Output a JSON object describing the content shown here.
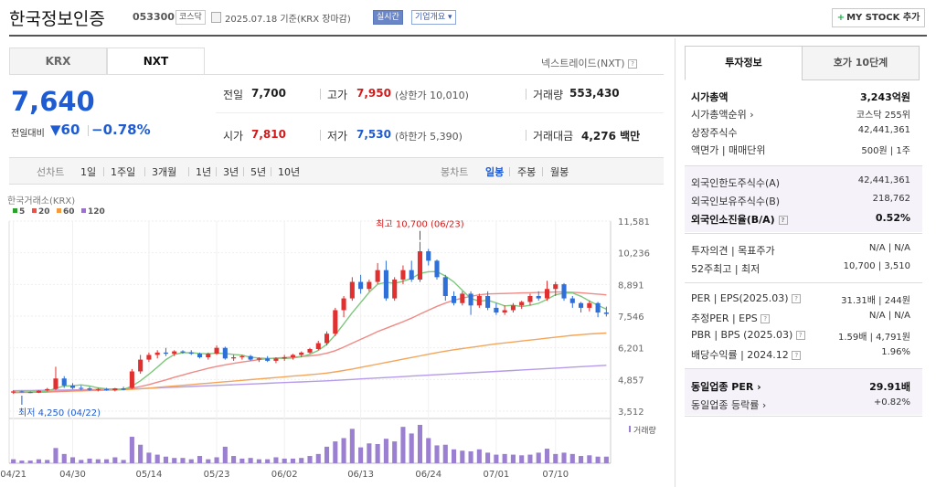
{
  "header": {
    "title": "한국정보인증",
    "code": "053300",
    "market_tag": "코스닥",
    "date_text": "2025.07.18  기준(KRX 장마감)",
    "realtime_tag": "실시간",
    "company_tag": "기업개요 ▾",
    "mystock_label": "MY STOCK 추가"
  },
  "tabs": {
    "krx": "KRX",
    "nxt": "NXT"
  },
  "nxt_link": "넥스트레이드(NXT)",
  "quote": {
    "price": "7,640",
    "change_label": "전일대비",
    "change_value": "▼60",
    "change_pct": "−0.78%",
    "prev_label": "전일",
    "prev": "7,700",
    "high_label": "고가",
    "high": "7,950",
    "upper_limit": "(상한가 10,010)",
    "volume_label": "거래량",
    "volume": "553,430",
    "open_label": "시가",
    "open": "7,810",
    "low_label": "저가",
    "low": "7,530",
    "lower_limit": "(하한가 5,390)",
    "amount_label": "거래대금",
    "amount": "4,276 백만"
  },
  "periods": {
    "line_label": "선차트",
    "items": [
      "1일",
      "1주일",
      "3개월",
      "1년",
      "3년",
      "5년",
      "10년"
    ],
    "candle_label": "봉차트",
    "candle_items": [
      "일봉",
      "주봉",
      "월봉"
    ],
    "selected": "일봉"
  },
  "right": {
    "tab_info": "투자정보",
    "tab_hoga": "호가 10단계",
    "market_cap_label": "시가총액",
    "market_cap": "3,243억원",
    "rank_label": "시가총액순위 ›",
    "rank": "코스닥 255위",
    "shares_label": "상장주식수",
    "shares": "42,441,361",
    "par_label": "액면가 | 매매단위",
    "par": "500원 | 1주",
    "foreign_limit_label": "외국인한도주식수(A)",
    "foreign_limit": "42,441,361",
    "foreign_hold_label": "외국인보유주식수(B)",
    "foreign_hold": "218,762",
    "foreign_ratio_label": "외국인소진율(B/A)",
    "foreign_ratio": "0.52%",
    "opinion_label": "투자의견 | 목표주가",
    "opinion": "N/A | N/A",
    "week52_label": "52주최고 | 최저",
    "week52": "10,700 | 3,510",
    "per_label": "PER | EPS(2025.03)",
    "per": "31.31배 | 244원",
    "est_per_label": "추정PER | EPS",
    "est_per": "N/A | N/A",
    "pbr_label": "PBR | BPS (2025.03)",
    "pbr": "1.59배 | 4,791원",
    "div_label": "배당수익률 | 2024.12",
    "div": "1.96%",
    "sector_per_label": "동일업종 PER ›",
    "sector_per": "29.91배",
    "sector_chg_label": "동일업종 등락률 ›",
    "sector_chg": "+0.82%"
  },
  "chart_data": {
    "type": "candlestick",
    "source_label": "한국거래소(KRX)",
    "ma_legend": [
      {
        "name": "5",
        "color": "#2ca02c"
      },
      {
        "name": "20",
        "color": "#e8524a"
      },
      {
        "name": "60",
        "color": "#f39a3e"
      },
      {
        "name": "120",
        "color": "#9d6fd6"
      }
    ],
    "yticks": [
      11581,
      10236,
      8891,
      7546,
      6201,
      4857,
      3512
    ],
    "ylim": [
      3512,
      11581
    ],
    "xticks": [
      "04/21",
      "04/30",
      "05/14",
      "05/23",
      "06/02",
      "06/13",
      "06/24",
      "07/01",
      "07/10"
    ],
    "high_annotation": "최고 10,700 (06/23)",
    "low_annotation": "최저 4,250 (04/22)",
    "volume_label": "거래량",
    "up_color": "#e03030",
    "down_color": "#2e6fd8",
    "ohlc": [
      [
        4300,
        4400,
        4250,
        4350
      ],
      [
        4350,
        4380,
        4300,
        4320
      ],
      [
        4320,
        4350,
        4280,
        4300
      ],
      [
        4300,
        4400,
        4280,
        4380
      ],
      [
        4400,
        4500,
        4350,
        4450
      ],
      [
        4450,
        5400,
        4400,
        4900
      ],
      [
        4900,
        5000,
        4500,
        4600
      ],
      [
        4600,
        4700,
        4450,
        4500
      ],
      [
        4500,
        4600,
        4400,
        4480
      ],
      [
        4480,
        4550,
        4380,
        4420
      ],
      [
        4420,
        4500,
        4350,
        4450
      ],
      [
        4450,
        4500,
        4380,
        4400
      ],
      [
        4400,
        4500,
        4350,
        4480
      ],
      [
        4480,
        4550,
        4400,
        4420
      ],
      [
        4500,
        5300,
        4450,
        5200
      ],
      [
        5200,
        5900,
        5100,
        5700
      ],
      [
        5700,
        6000,
        5600,
        5900
      ],
      [
        5900,
        6100,
        5750,
        6000
      ],
      [
        6000,
        6200,
        5850,
        5950
      ],
      [
        5950,
        6100,
        5850,
        6050
      ],
      [
        6050,
        6100,
        5950,
        6000
      ],
      [
        6000,
        6100,
        5900,
        5950
      ],
      [
        5950,
        6000,
        5750,
        5800
      ],
      [
        5800,
        6000,
        5700,
        5950
      ],
      [
        5950,
        6300,
        5900,
        6200
      ],
      [
        6200,
        6250,
        5700,
        5750
      ],
      [
        5750,
        5900,
        5650,
        5800
      ],
      [
        5800,
        5900,
        5700,
        5850
      ],
      [
        5850,
        5900,
        5650,
        5700
      ],
      [
        5700,
        5800,
        5600,
        5750
      ],
      [
        5750,
        5850,
        5600,
        5650
      ],
      [
        5650,
        5800,
        5550,
        5750
      ],
      [
        5750,
        5900,
        5650,
        5800
      ],
      [
        5800,
        5950,
        5700,
        5900
      ],
      [
        5900,
        6050,
        5800,
        6000
      ],
      [
        6000,
        6200,
        5950,
        6150
      ],
      [
        6150,
        6500,
        6100,
        6400
      ],
      [
        6400,
        6900,
        6300,
        6800
      ],
      [
        6800,
        7900,
        6700,
        7800
      ],
      [
        7800,
        8400,
        7500,
        8300
      ],
      [
        8300,
        9200,
        8200,
        9000
      ],
      [
        9000,
        9300,
        8500,
        8700
      ],
      [
        8700,
        9100,
        8600,
        9000
      ],
      [
        9000,
        9800,
        8900,
        9500
      ],
      [
        9500,
        9900,
        8200,
        8300
      ],
      [
        8300,
        9200,
        8200,
        9100
      ],
      [
        9100,
        9700,
        8900,
        9500
      ],
      [
        9500,
        9900,
        9000,
        9100
      ],
      [
        9100,
        10700,
        9000,
        10300
      ],
      [
        10300,
        10400,
        9700,
        9900
      ],
      [
        9900,
        9950,
        9100,
        9200
      ],
      [
        9200,
        9300,
        8200,
        8400
      ],
      [
        8400,
        8600,
        8000,
        8100
      ],
      [
        8100,
        8600,
        8000,
        8500
      ],
      [
        8500,
        8600,
        7600,
        8000
      ],
      [
        8000,
        8500,
        7900,
        8400
      ],
      [
        8400,
        8600,
        7800,
        7900
      ],
      [
        7900,
        8100,
        7600,
        7700
      ],
      [
        7700,
        8000,
        7600,
        7800
      ],
      [
        7800,
        8100,
        7700,
        8000
      ],
      [
        8000,
        8200,
        7850,
        8150
      ],
      [
        8150,
        8500,
        8000,
        8400
      ],
      [
        8400,
        8600,
        8200,
        8300
      ],
      [
        8300,
        9050,
        8200,
        8700
      ],
      [
        8700,
        9000,
        8400,
        8900
      ],
      [
        8900,
        8950,
        8200,
        8300
      ],
      [
        8300,
        8400,
        7900,
        8100
      ],
      [
        8100,
        8150,
        7700,
        7900
      ],
      [
        7900,
        8200,
        7750,
        8100
      ],
      [
        8100,
        8150,
        7500,
        7700
      ],
      [
        7700,
        7950,
        7530,
        7640
      ]
    ],
    "volume": [
      6,
      4,
      4,
      6,
      5,
      23,
      14,
      9,
      5,
      7,
      6,
      6,
      9,
      5,
      40,
      28,
      16,
      13,
      10,
      8,
      8,
      6,
      11,
      6,
      9,
      25,
      11,
      7,
      8,
      6,
      6,
      9,
      7,
      7,
      8,
      11,
      14,
      25,
      33,
      38,
      52,
      24,
      30,
      29,
      37,
      33,
      55,
      45,
      58,
      38,
      27,
      28,
      21,
      19,
      18,
      21,
      16,
      13,
      14,
      13,
      12,
      13,
      16,
      22,
      14,
      16,
      14,
      11,
      12,
      10,
      10
    ],
    "ma5": [
      4300,
      4320,
      4330,
      4340,
      4360,
      4480,
      4580,
      4590,
      4630,
      4580,
      4500,
      4460,
      4450,
      4430,
      4580,
      4800,
      5080,
      5380,
      5700,
      5920,
      5990,
      6000,
      5960,
      5950,
      5980,
      5960,
      5920,
      5890,
      5800,
      5770,
      5750,
      5760,
      5750,
      5770,
      5820,
      5930,
      6090,
      6350,
      6750,
      7220,
      7690,
      8120,
      8560,
      8900,
      8980,
      8940,
      9030,
      9150,
      9360,
      9430,
      9440,
      9250,
      9000,
      8640,
      8300,
      8180,
      8220,
      8110,
      7980,
      8010,
      7950,
      8010,
      8090,
      8260,
      8460,
      8520,
      8530,
      8390,
      8190,
      8010,
      7840
    ],
    "ma20": [
      4300,
      4305,
      4310,
      4315,
      4320,
      4340,
      4360,
      4380,
      4400,
      4410,
      4420,
      4430,
      4440,
      4450,
      4490,
      4560,
      4640,
      4740,
      4840,
      4950,
      5050,
      5150,
      5240,
      5330,
      5410,
      5480,
      5540,
      5600,
      5650,
      5700,
      5740,
      5770,
      5790,
      5810,
      5830,
      5860,
      5900,
      5970,
      6080,
      6230,
      6400,
      6560,
      6720,
      6890,
      7030,
      7170,
      7310,
      7460,
      7630,
      7800,
      7960,
      8100,
      8220,
      8310,
      8390,
      8450,
      8490,
      8500,
      8510,
      8520,
      8530,
      8540,
      8550,
      8560,
      8570,
      8570,
      8560,
      8540,
      8510,
      8480,
      8450
    ],
    "ma60": [
      4320,
      4325,
      4330,
      4335,
      4340,
      4345,
      4350,
      4360,
      4370,
      4380,
      4390,
      4400,
      4410,
      4420,
      4440,
      4460,
      4490,
      4520,
      4550,
      4580,
      4610,
      4640,
      4670,
      4700,
      4730,
      4760,
      4790,
      4820,
      4850,
      4880,
      4910,
      4940,
      4970,
      5000,
      5030,
      5060,
      5090,
      5130,
      5180,
      5240,
      5300,
      5370,
      5440,
      5510,
      5580,
      5650,
      5720,
      5790,
      5860,
      5930,
      6000,
      6060,
      6120,
      6170,
      6220,
      6270,
      6320,
      6370,
      6410,
      6450,
      6490,
      6530,
      6570,
      6610,
      6650,
      6690,
      6730,
      6760,
      6790,
      6810,
      6830
    ],
    "ma120": [
      4380,
      4385,
      4390,
      4395,
      4400,
      4405,
      4410,
      4415,
      4420,
      4425,
      4430,
      4435,
      4440,
      4445,
      4455,
      4470,
      4485,
      4500,
      4515,
      4530,
      4545,
      4560,
      4575,
      4590,
      4605,
      4620,
      4635,
      4650,
      4665,
      4680,
      4695,
      4710,
      4725,
      4740,
      4755,
      4770,
      4785,
      4800,
      4820,
      4840,
      4860,
      4880,
      4900,
      4920,
      4940,
      4960,
      4980,
      5000,
      5020,
      5040,
      5060,
      5080,
      5100,
      5120,
      5140,
      5160,
      5180,
      5200,
      5220,
      5240,
      5260,
      5280,
      5300,
      5320,
      5340,
      5360,
      5380,
      5400,
      5420,
      5440,
      5460
    ]
  }
}
